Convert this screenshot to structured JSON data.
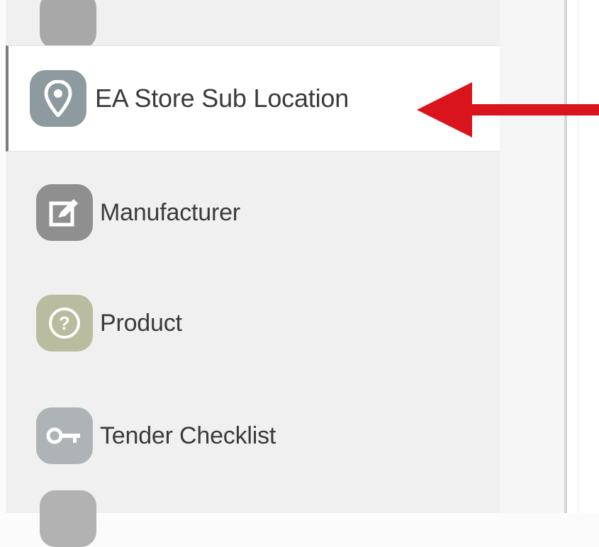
{
  "sidebar": {
    "items": [
      {
        "label": "",
        "icon": "partial-icon"
      },
      {
        "label": "EA Store Sub Location",
        "icon": "location-pin-icon",
        "active": true
      },
      {
        "label": "Manufacturer",
        "icon": "edit-icon"
      },
      {
        "label": "Product",
        "icon": "question-icon"
      },
      {
        "label": "Tender Checklist",
        "icon": "key-icon"
      },
      {
        "label": "",
        "icon": "partial-icon"
      }
    ]
  },
  "annotation": {
    "arrow_color": "#d9141c",
    "points_to": "EA Store Sub Location"
  }
}
